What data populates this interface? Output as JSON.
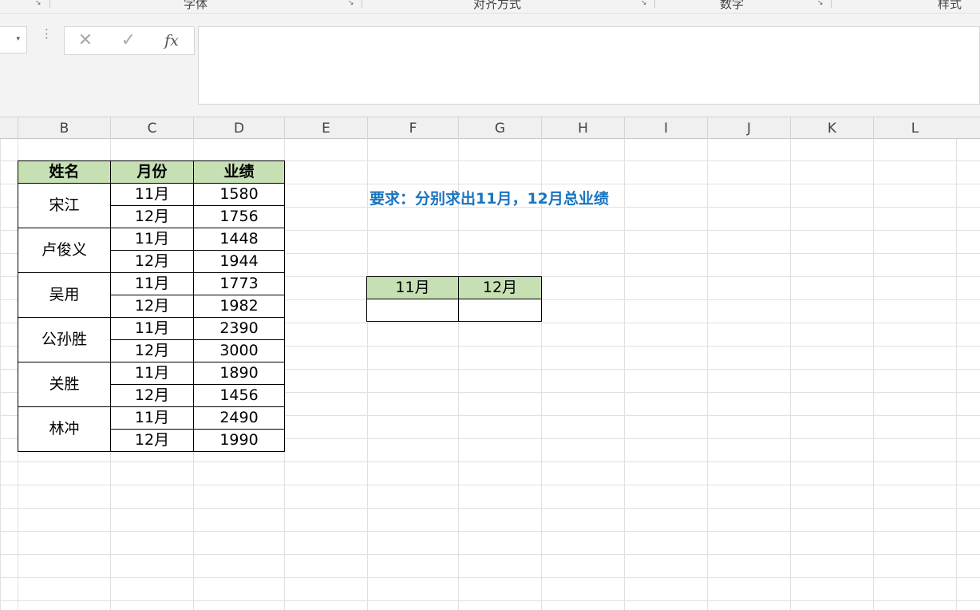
{
  "ribbon": {
    "groups": [
      {
        "label": "字体"
      },
      {
        "label": "对齐方式"
      },
      {
        "label": "数字"
      },
      {
        "label": "样式"
      }
    ]
  },
  "formula_bar": {
    "cancel_glyph": "✕",
    "enter_glyph": "✓",
    "fx_glyph": "fx",
    "dots_glyph": "⋮",
    "dropdown_glyph": "▾",
    "value": ""
  },
  "columns": [
    "B",
    "C",
    "D",
    "E",
    "F",
    "G",
    "H",
    "I",
    "J",
    "K",
    "L"
  ],
  "main_table": {
    "headers": [
      "姓名",
      "月份",
      "业绩"
    ],
    "rows": [
      {
        "name": "宋江",
        "m1": "11月",
        "v1": "1580",
        "m2": "12月",
        "v2": "1756"
      },
      {
        "name": "卢俊义",
        "m1": "11月",
        "v1": "1448",
        "m2": "12月",
        "v2": "1944"
      },
      {
        "name": "吴用",
        "m1": "11月",
        "v1": "1773",
        "m2": "12月",
        "v2": "1982"
      },
      {
        "name": "公孙胜",
        "m1": "11月",
        "v1": "2390",
        "m2": "12月",
        "v2": "3000"
      },
      {
        "name": "关胜",
        "m1": "11月",
        "v1": "1890",
        "m2": "12月",
        "v2": "1456"
      },
      {
        "name": "林冲",
        "m1": "11月",
        "v1": "2490",
        "m2": "12月",
        "v2": "1990"
      }
    ]
  },
  "requirement": "要求：分别求出11月，12月总业绩",
  "summary_table": {
    "headers": [
      "11月",
      "12月"
    ],
    "values": [
      "",
      ""
    ]
  },
  "colors": {
    "header_fill": "#c6e0b4",
    "requirement_text": "#1a74c0"
  }
}
